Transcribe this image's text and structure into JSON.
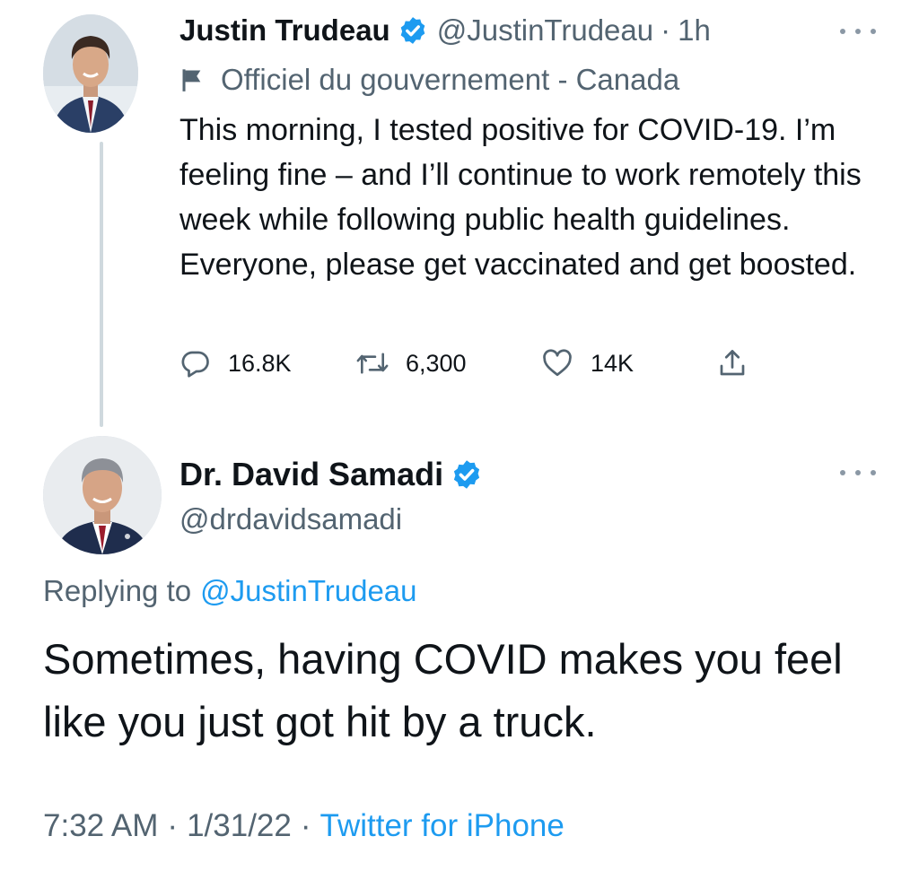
{
  "colors": {
    "text": "#0f1419",
    "secondary": "#536471",
    "accent": "#1d9bf0",
    "thread_line": "#cfd9de"
  },
  "original_tweet": {
    "author_name": "Justin Trudeau",
    "verified_icon": "verified-badge-icon",
    "handle": "@JustinTrudeau",
    "separator": "·",
    "time_ago": "1h",
    "label_icon": "flag-icon",
    "label": "Officiel du gouvernement - Canada",
    "text": "This morning, I tested positive for COVID-19. I’m feeling fine – and I’ll continue to work remotely this week while following public health guidelines. Everyone, please get vaccinated and get boosted.",
    "actions": {
      "reply_icon": "reply-icon",
      "reply_count": "16.8K",
      "retweet_icon": "retweet-icon",
      "retweet_count": "6,300",
      "like_icon": "heart-icon",
      "like_count": "14K",
      "share_icon": "share-icon"
    },
    "more_icon": "more-options-icon"
  },
  "reply_tweet": {
    "author_name": "Dr. David Samadi",
    "verified_icon": "verified-badge-icon",
    "handle": "@drdavidsamadi",
    "more_icon": "more-options-icon",
    "replying_prefix": "Replying to",
    "replying_mention": "@JustinTrudeau",
    "text": "Sometimes, having COVID makes you feel like you just got hit by a truck.",
    "time": "7:32 AM",
    "date": "1/31/22",
    "separator": "·",
    "source": "Twitter for iPhone"
  }
}
